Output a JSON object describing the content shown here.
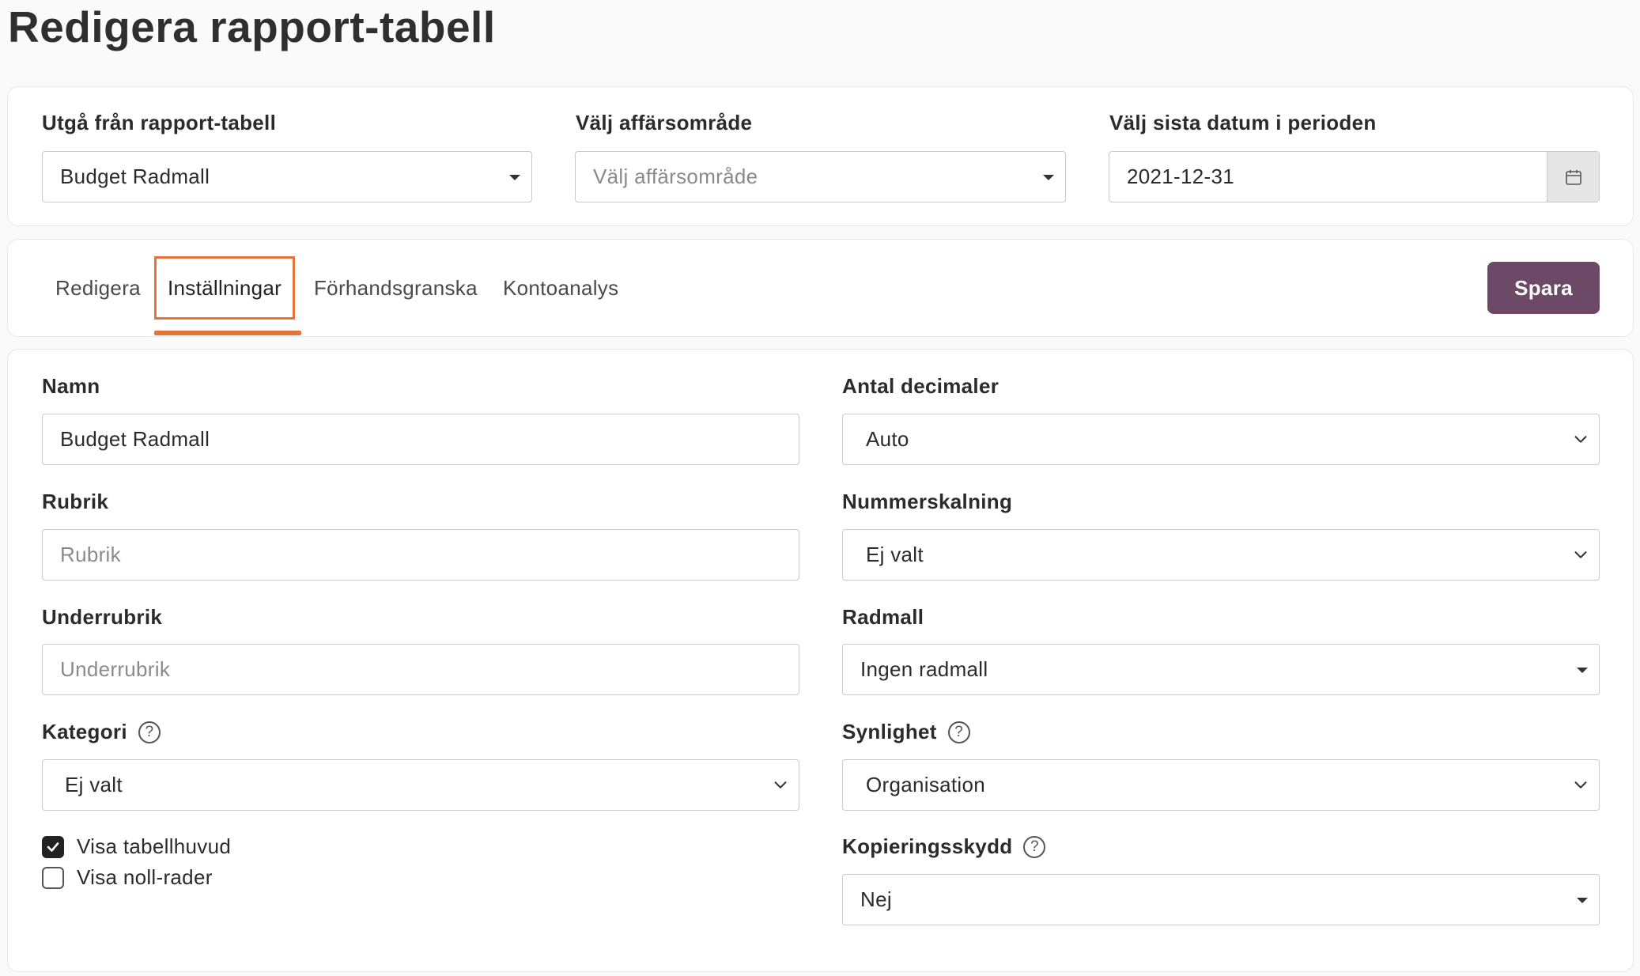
{
  "page": {
    "title": "Redigera rapport-tabell"
  },
  "filters": {
    "base_table": {
      "label": "Utgå från rapport-tabell",
      "value": "Budget Radmall"
    },
    "business_area": {
      "label": "Välj affärsområde",
      "placeholder": "Välj affärsområde"
    },
    "period_end": {
      "label": "Välj sista datum i perioden",
      "value": "2021-12-31"
    }
  },
  "tabs": [
    {
      "label": "Redigera",
      "active": false
    },
    {
      "label": "Inställningar",
      "active": true
    },
    {
      "label": "Förhandsgranska",
      "active": false
    },
    {
      "label": "Kontoanalys",
      "active": false
    }
  ],
  "toolbar": {
    "save_label": "Spara",
    "save_color": "#6c4966",
    "active_tab_color": "#e6733a"
  },
  "form": {
    "name": {
      "label": "Namn",
      "value": "Budget Radmall"
    },
    "heading": {
      "label": "Rubrik",
      "placeholder": "Rubrik"
    },
    "subheading": {
      "label": "Underrubrik",
      "placeholder": "Underrubrik"
    },
    "category": {
      "label": "Kategori",
      "value": "Ej valt",
      "help_icon": "question-circle-icon"
    },
    "decimals": {
      "label": "Antal decimaler",
      "value": "Auto"
    },
    "scaling": {
      "label": "Nummerskalning",
      "value": "Ej valt"
    },
    "row_template": {
      "label": "Radmall",
      "value": "Ingen radmall"
    },
    "visibility": {
      "label": "Synlighet",
      "value": "Organisation",
      "help_icon": "question-circle-icon"
    },
    "copy_protection": {
      "label": "Kopieringsskydd",
      "value": "Nej",
      "help_icon": "question-circle-icon"
    },
    "show_header": {
      "label": "Visa tabellhuvud",
      "checked": true
    },
    "show_zero_rows": {
      "label": "Visa noll-rader",
      "checked": false
    }
  }
}
